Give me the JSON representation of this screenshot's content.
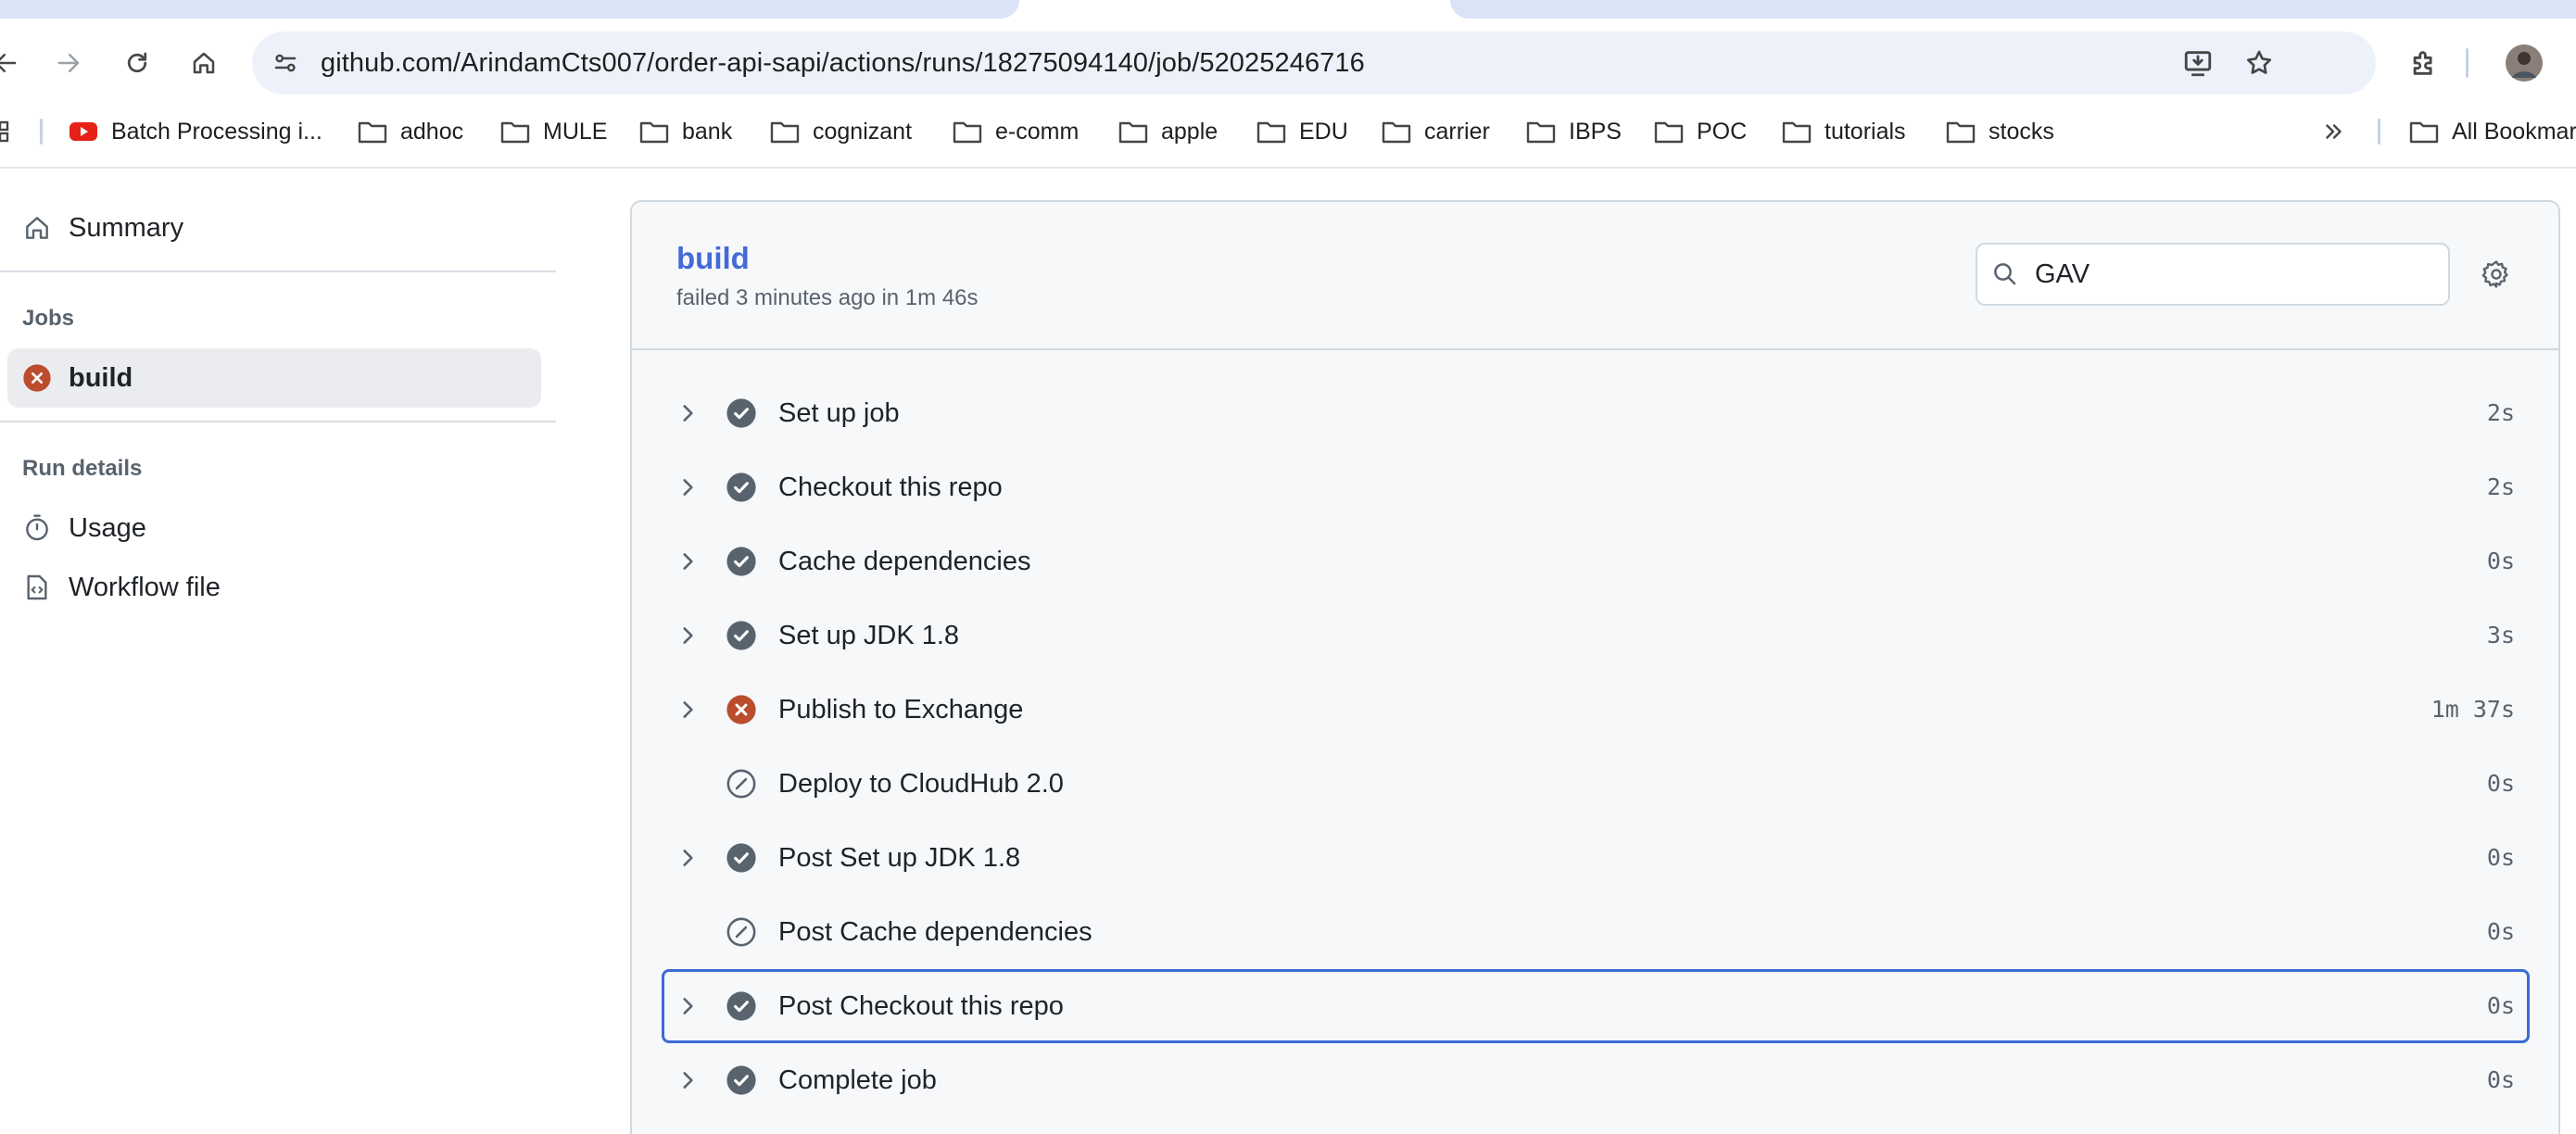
{
  "browser": {
    "url": "github.com/ArindamCts007/order-api-sapi/actions/runs/18275094140/job/52025246716",
    "bookmarks": [
      {
        "label": "Batch Processing i...",
        "icon": "youtube-icon"
      },
      {
        "label": "adhoc",
        "icon": "folder-icon"
      },
      {
        "label": "MULE",
        "icon": "folder-icon"
      },
      {
        "label": "bank",
        "icon": "folder-icon"
      },
      {
        "label": "cognizant",
        "icon": "folder-icon"
      },
      {
        "label": "e-comm",
        "icon": "folder-icon"
      },
      {
        "label": "apple",
        "icon": "folder-icon"
      },
      {
        "label": "EDU",
        "icon": "folder-icon"
      },
      {
        "label": "carrier",
        "icon": "folder-icon"
      },
      {
        "label": "IBPS",
        "icon": "folder-icon"
      },
      {
        "label": "POC",
        "icon": "folder-icon"
      },
      {
        "label": "tutorials",
        "icon": "folder-icon"
      },
      {
        "label": "stocks",
        "icon": "folder-icon"
      }
    ],
    "all_bookmarks_label": "All Bookmar"
  },
  "sidebar": {
    "summary_label": "Summary",
    "jobs_heading": "Jobs",
    "job_label": "build",
    "run_details_heading": "Run details",
    "usage_label": "Usage",
    "workflow_file_label": "Workflow file"
  },
  "job": {
    "title": "build",
    "subtitle": "failed 3 minutes ago in 1m 46s",
    "search_value": "GAV",
    "steps": [
      {
        "name": "Set up job",
        "duration": "2s",
        "status": "success",
        "expandable": true
      },
      {
        "name": "Checkout this repo",
        "duration": "2s",
        "status": "success",
        "expandable": true
      },
      {
        "name": "Cache dependencies",
        "duration": "0s",
        "status": "success",
        "expandable": true
      },
      {
        "name": "Set up JDK 1.8",
        "duration": "3s",
        "status": "success",
        "expandable": true
      },
      {
        "name": "Publish to Exchange",
        "duration": "1m 37s",
        "status": "failure",
        "expandable": true
      },
      {
        "name": "Deploy to CloudHub 2.0",
        "duration": "0s",
        "status": "skipped",
        "expandable": false
      },
      {
        "name": "Post Set up JDK 1.8",
        "duration": "0s",
        "status": "success",
        "expandable": true
      },
      {
        "name": "Post Cache dependencies",
        "duration": "0s",
        "status": "skipped",
        "expandable": false
      },
      {
        "name": "Post Checkout this repo",
        "duration": "0s",
        "status": "success",
        "expandable": true,
        "focused": true
      },
      {
        "name": "Complete job",
        "duration": "0s",
        "status": "success",
        "expandable": true
      }
    ]
  },
  "colors": {
    "success": "#59636e",
    "failure": "#bc4c2e",
    "link": "#4469d8",
    "focus": "#3b6bd6"
  }
}
